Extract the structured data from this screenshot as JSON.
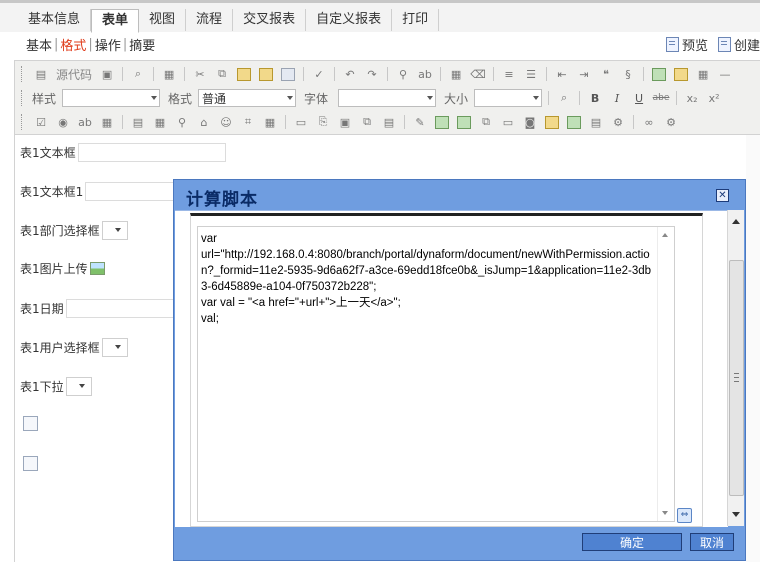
{
  "top_tabs": [
    "基本信息",
    "表单",
    "视图",
    "流程",
    "交叉报表",
    "自定义报表",
    "打印"
  ],
  "active_tab": "表单",
  "sub_nav": [
    "基本",
    "格式",
    "操作",
    "摘要"
  ],
  "active_sub": "格式",
  "actions": {
    "preview": "预览",
    "create": "创建"
  },
  "toolbar": {
    "source_label": "源代码",
    "style_label": "样式",
    "format_label": "格式",
    "format_value": "普通",
    "font_label": "字体",
    "size_label": "大小",
    "bold": "B",
    "italic": "I",
    "underline": "U",
    "strike": "abe",
    "subscript": "x₂",
    "superscript": "x²"
  },
  "form_fields": [
    {
      "label": "表1文本框",
      "kind": "text"
    },
    {
      "label": "表1文本框1",
      "kind": "text"
    },
    {
      "label": "表1部门选择框",
      "kind": "select"
    },
    {
      "label": "表1图片上传",
      "kind": "image"
    },
    {
      "label": "表1日期",
      "kind": "text"
    },
    {
      "label": "表1用户选择框",
      "kind": "select"
    },
    {
      "label": "表1下拉",
      "kind": "select"
    }
  ],
  "dialog": {
    "title": "计算脚本",
    "code": "var\nurl=\"http://192.168.0.4:8080/branch/portal/dynaform/document/newWithPermission.action?_formid=11e2-5935-9d6a62f7-a3ce-69edd18fce0b&_isJump=1&application=11e2-3db3-6d45889e-a104-0f750372b228\";\nvar val = \"<a href=\"+url+\">上一天</a>\";\nval;",
    "ok_label": "确定",
    "cancel_label": "取消",
    "close_icon": "close-icon"
  }
}
